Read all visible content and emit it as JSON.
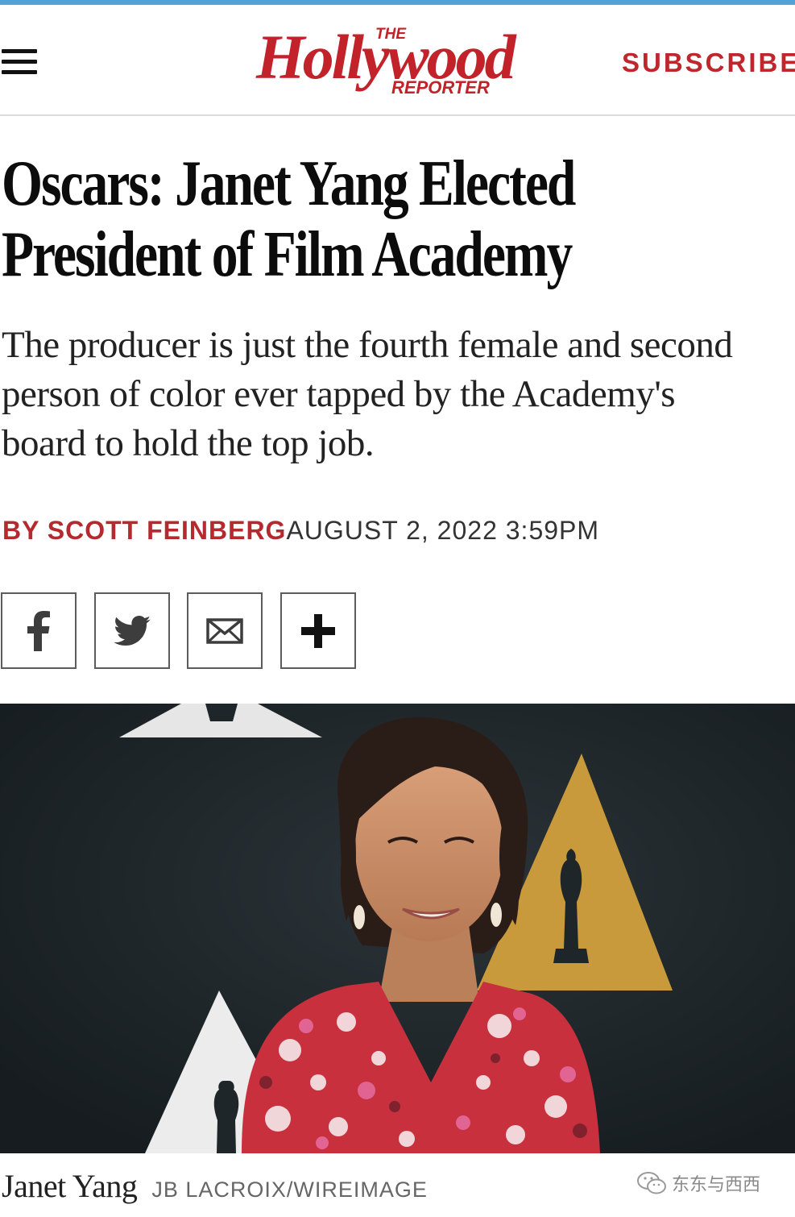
{
  "header": {
    "logo": {
      "the": "THE",
      "main": "Hollywood",
      "reporter": "REPORTER"
    },
    "subscribe_label": "SUBSCRIBE",
    "menu_icon": "hamburger-menu-icon"
  },
  "article": {
    "headline_line1": "Oscars: Janet Yang Elected",
    "headline_line2": "President of Film Academy",
    "dek": "The producer is just the fourth female and second person of color ever tapped by the Academy's board to hold the top job.",
    "byline_author": "BY SCOTT FEINBERG",
    "byline_date": "AUGUST 2, 2022 3:59PM"
  },
  "share": [
    {
      "name": "facebook",
      "icon": "facebook-icon"
    },
    {
      "name": "twitter",
      "icon": "twitter-icon"
    },
    {
      "name": "email",
      "icon": "email-icon"
    },
    {
      "name": "more",
      "icon": "plus-icon"
    }
  ],
  "photo": {
    "caption_name": "Janet Yang",
    "caption_credit": "JB LACROIX/WIREIMAGE"
  },
  "watermark": {
    "text": "东东与西西",
    "icon": "wechat-icon"
  },
  "colors": {
    "brand_red": "#c2222a",
    "top_strip": "#4fa3d9",
    "photo_background": "#1f2629",
    "academy_gold": "#c99a3b"
  }
}
